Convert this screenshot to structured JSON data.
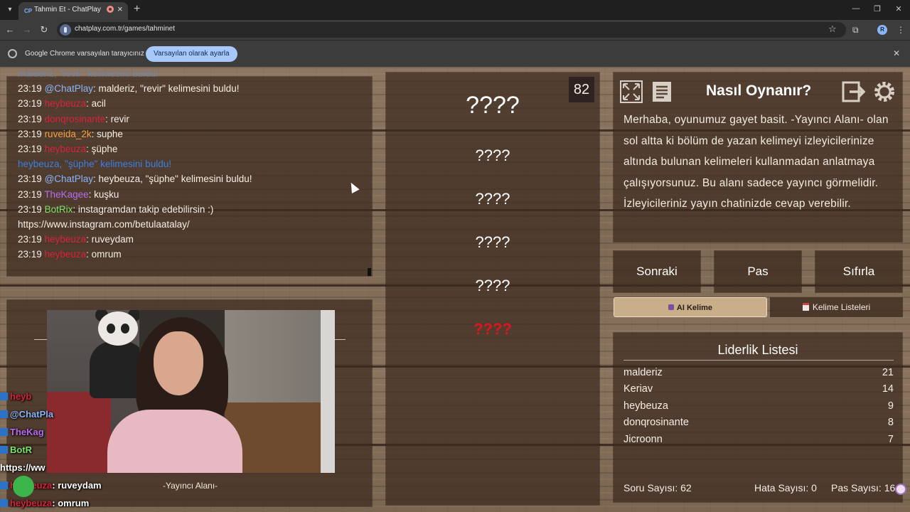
{
  "browser": {
    "tab_title": "Tahmin Et - ChatPlay",
    "tab_favicon": "CP",
    "url": "chatplay.com.tr/games/tahminet",
    "profile_initial": "R",
    "infobar_text": "Google Chrome varsayılan tarayıcınız değil",
    "infobar_button": "Varsayılan olarak ayarla"
  },
  "chat": {
    "lines": [
      {
        "time": "",
        "user": "malderiz, \"revir\" kelimesini buldu!",
        "user_color": "#5b8bd6",
        "msg": "",
        "faded": true
      },
      {
        "time": "23:19",
        "user": "@ChatPlay",
        "user_color": "#8ab4f8",
        "msg": ": malderiz, \"revir\" kelimesini buldu!"
      },
      {
        "time": "23:19",
        "user": "heybeuza",
        "user_color": "#d9223b",
        "msg": ": acil"
      },
      {
        "time": "23:19",
        "user": "donqrosinante",
        "user_color": "#d9223b",
        "msg": ": revir"
      },
      {
        "time": "23:19",
        "user": "ruveida_2k",
        "user_color": "#f0a040",
        "msg": ": suphe"
      },
      {
        "time": "23:19",
        "user": "heybeuza",
        "user_color": "#d9223b",
        "msg": ": şüphe"
      },
      {
        "time": "",
        "user": "heybeuza, \"şüphe\" kelimesini buldu!",
        "user_color": "#3b7fe0",
        "msg": ""
      },
      {
        "time": "23:19",
        "user": "@ChatPlay",
        "user_color": "#8ab4f8",
        "msg": ": heybeuza, \"şüphe\" kelimesini buldu!"
      },
      {
        "time": "23:19",
        "user": "TheKagee",
        "user_color": "#b76bf0",
        "msg": ": kuşku"
      },
      {
        "time": "23:19",
        "user": "BotRix",
        "user_color": "#7be36b",
        "msg": ": instagramdan takip edebilirsin :)"
      },
      {
        "time": "",
        "user": "",
        "user_color": "#f4eee6",
        "msg": "https://www.instagram.com/betulaatalay/"
      },
      {
        "time": "23:19",
        "user": "heybeuza",
        "user_color": "#d9223b",
        "msg": ": ruveydam"
      },
      {
        "time": "23:19",
        "user": "heybeuza",
        "user_color": "#d9223b",
        "msg": ": omrum"
      }
    ]
  },
  "overlay_chat": [
    {
      "user": "heyb",
      "color": "#d9223b",
      "msg": ""
    },
    {
      "user": "@ChatPla",
      "color": "#8ab4f8",
      "msg": ""
    },
    {
      "user": "TheKag",
      "color": "#b76bf0",
      "msg": ""
    },
    {
      "user": "BotR",
      "color": "#7be36b",
      "msg": ""
    },
    {
      "user": "https://ww",
      "color": "#ffffff",
      "msg": ""
    },
    {
      "user": "heybeuza",
      "color": "#d9223b",
      "msg": ": ruveydam"
    },
    {
      "user": "heybeuza",
      "color": "#d9223b",
      "msg": ": omrum"
    }
  ],
  "stream": {
    "label": "-Yayıncı Alanı-"
  },
  "game": {
    "counter": "82",
    "main_word": "????",
    "taboo_words": [
      "????",
      "????",
      "????",
      "????"
    ],
    "red_word": "????"
  },
  "howto": {
    "title": "Nasıl Oynanır?",
    "text": "Merhaba, oyunumuz gayet basit. -Yayıncı Alanı- olan sol altta ki bölüm de yazan kelimeyi izleyicilerinize altında bulunan kelimeleri kullanmadan anlatmaya çalışıyorsunuz. Bu alanı sadece yayıncı görmelidir. İzleyicileriniz yayın chatinizde cevap verebilir.",
    "icons": [
      "expand-icon",
      "document-icon",
      "exit-icon",
      "gear-icon"
    ]
  },
  "controls": {
    "next": "Sonraki",
    "pass": "Pas",
    "reset": "Sıfırla",
    "ai_word": "AI Kelime",
    "word_lists": "Kelime Listeleri"
  },
  "leaderboard": {
    "title": "Liderlik Listesi",
    "rows": [
      {
        "name": "malderiz",
        "score": "21"
      },
      {
        "name": "Keriav",
        "score": "14"
      },
      {
        "name": "heybeuza",
        "score": "9"
      },
      {
        "name": "donqrosinante",
        "score": "8"
      },
      {
        "name": "Jicroonn",
        "score": "7"
      }
    ]
  },
  "stats": {
    "questions": "Soru Sayısı: 62",
    "errors": "Hata Sayısı: 0",
    "passes": "Pas Sayısı: 16"
  }
}
